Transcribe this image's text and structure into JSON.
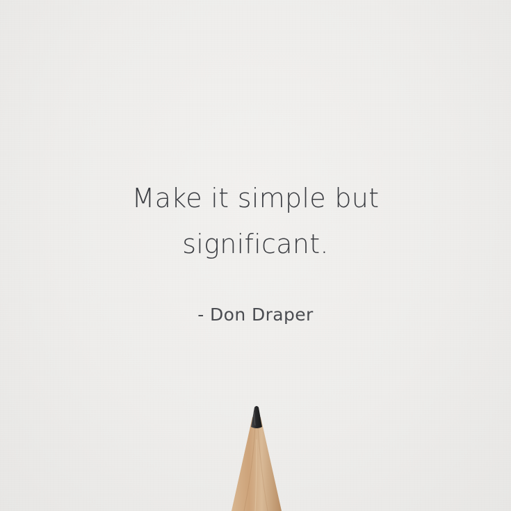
{
  "quote": {
    "text": "Make it simple but significant.",
    "author": "- Don Draper"
  },
  "colors": {
    "background": "#efeeec",
    "text": "#3b3d42",
    "pencil_wood": "#c9a57f",
    "pencil_lead": "#2f2f31"
  },
  "icons": {
    "pencil": "pencil-icon"
  }
}
